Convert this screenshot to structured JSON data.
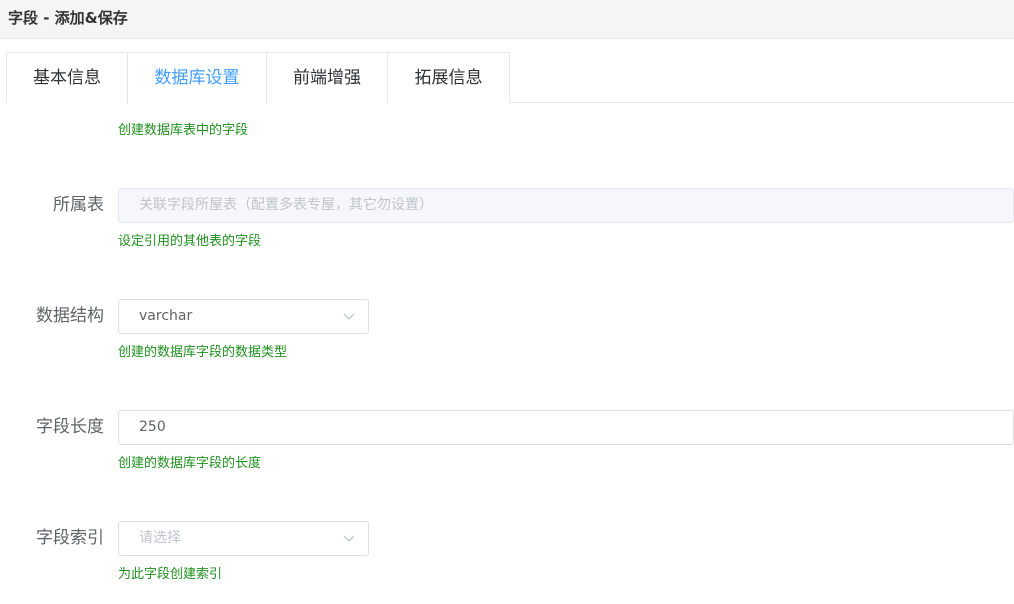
{
  "window": {
    "title": "字段 - 添加&保存"
  },
  "tabs": [
    {
      "label": "基本信息",
      "active": false
    },
    {
      "label": "数据库设置",
      "active": true
    },
    {
      "label": "前端增强",
      "active": false
    },
    {
      "label": "拓展信息",
      "active": false
    }
  ],
  "form": {
    "top_hint": "创建数据库表中的字段",
    "owner_table": {
      "label": "所属表",
      "placeholder": "关联字段所屋表（配置多表专屋，其它勿设置）",
      "hint": "设定引用的其他表的字段"
    },
    "data_structure": {
      "label": "数据结构",
      "value": "varchar",
      "hint": "创建的数据库字段的数据类型"
    },
    "field_length": {
      "label": "字段长度",
      "value": "250",
      "hint": "创建的数据库字段的长度"
    },
    "field_index": {
      "label": "字段索引",
      "placeholder": "请选择",
      "hint": "为此字段创建索引"
    }
  },
  "colors": {
    "accent": "#409eff",
    "hint_green": "#1f8f1f"
  }
}
